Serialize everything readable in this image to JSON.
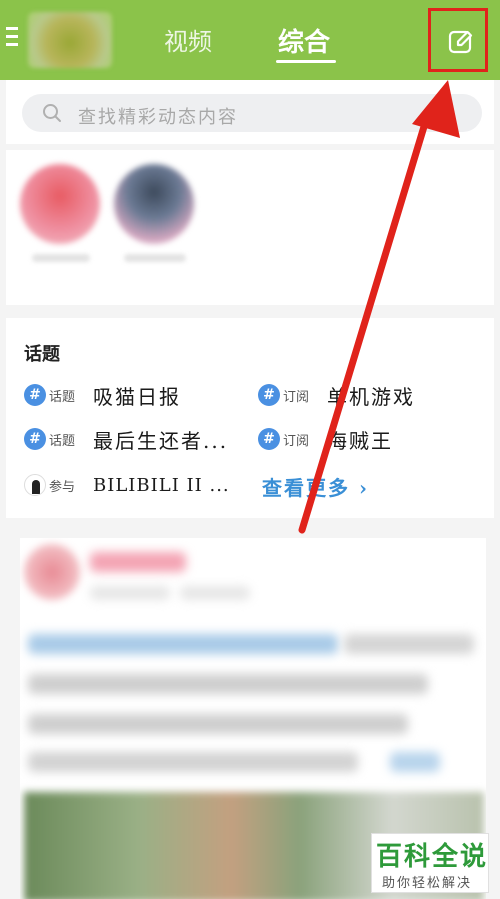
{
  "header": {
    "tabs": [
      {
        "label": "视频",
        "active": false
      },
      {
        "label": "综合",
        "active": true
      }
    ],
    "accent_color": "#8bc34a"
  },
  "search": {
    "placeholder": "查找精彩动态内容"
  },
  "topics": {
    "title": "话题",
    "items": [
      {
        "tag": "话题",
        "name": "吸猫日报",
        "icon": "hash-icon"
      },
      {
        "tag": "订阅",
        "name": "单机游戏",
        "icon": "hash-icon"
      },
      {
        "tag": "话题",
        "name": "最后生还者...",
        "icon": "hash-icon"
      },
      {
        "tag": "订阅",
        "name": "海贼王",
        "icon": "hash-icon"
      },
      {
        "tag": "参与",
        "name": "BILIBILI II ...",
        "icon": "participant-icon"
      }
    ],
    "see_more": "查看更多 ›"
  },
  "annotation": {
    "highlight_color": "#e0231b",
    "target": "compose-button"
  },
  "watermark": {
    "main": "百科全说",
    "sub": "助你轻松解决"
  }
}
